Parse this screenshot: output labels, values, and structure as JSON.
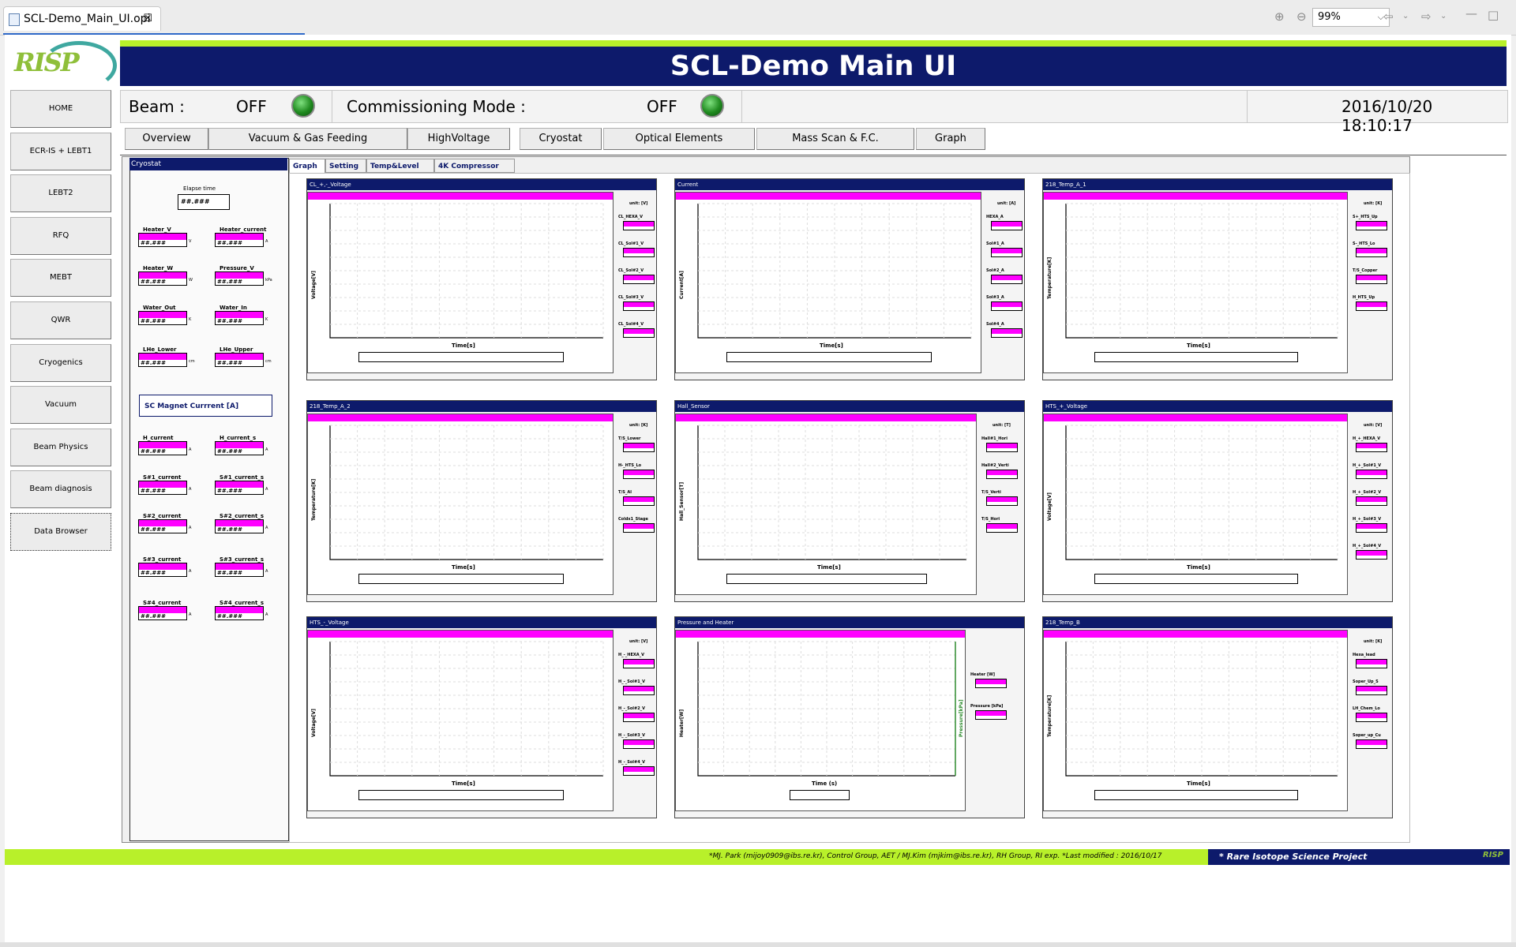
{
  "editor": {
    "tab_title": "SCL-Demo_Main_UI.opi",
    "zoom": "99%"
  },
  "app": {
    "title": "SCL-Demo Main UI",
    "logo_text": "RISP"
  },
  "sidebar": {
    "items": [
      {
        "label": "HOME"
      },
      {
        "label": "ECR-IS + LEBT1"
      },
      {
        "label": "LEBT2"
      },
      {
        "label": "RFQ"
      },
      {
        "label": "MEBT"
      },
      {
        "label": "QWR"
      },
      {
        "label": "Cryogenics"
      },
      {
        "label": "Vacuum"
      },
      {
        "label": "Beam Physics"
      },
      {
        "label": "Beam diagnosis"
      },
      {
        "label": "Data Browser"
      }
    ]
  },
  "status": {
    "beam_label": "Beam :",
    "beam_value": "OFF",
    "commissioning_label": "Commissioning Mode :",
    "commissioning_value": "OFF",
    "datetime": "2016/10/20 18:10:17",
    "led_color": "#1f8a1f"
  },
  "nav_tabs": [
    {
      "label": "Overview"
    },
    {
      "label": "Vacuum & Gas Feeding"
    },
    {
      "label": "HighVoltage"
    },
    {
      "label": "Cryostat"
    },
    {
      "label": "Optical Elements"
    },
    {
      "label": "Mass Scan & F.C."
    },
    {
      "label": "Graph"
    }
  ],
  "cryostat": {
    "header": "Cryostat",
    "elapse_label": "Elapse time",
    "elapse_value": "##.###",
    "placeholder": "##.###",
    "fields": [
      {
        "label": "Heater_V",
        "unit": "V"
      },
      {
        "label": "Heater_current",
        "unit": "A"
      },
      {
        "label": "Heater_W",
        "unit": "W"
      },
      {
        "label": "Pressure_V",
        "unit": "kPa"
      },
      {
        "label": "Water_Out",
        "unit": "K"
      },
      {
        "label": "Water_In",
        "unit": "K"
      },
      {
        "label": "LHe_Lower",
        "unit": "cm"
      },
      {
        "label": "LHe_Upper",
        "unit": "cm"
      }
    ],
    "magnet_title": "SC Magnet Currrent [A]",
    "magnet_fields": [
      {
        "label": "H_current",
        "unit": "A"
      },
      {
        "label": "H_current_s",
        "unit": "A"
      },
      {
        "label": "S#1_current",
        "unit": "A"
      },
      {
        "label": "S#1_current_s",
        "unit": "A"
      },
      {
        "label": "S#2_current",
        "unit": "A"
      },
      {
        "label": "S#2_current_s",
        "unit": "A"
      },
      {
        "label": "S#3_current",
        "unit": "A"
      },
      {
        "label": "S#3_current_s",
        "unit": "A"
      },
      {
        "label": "S#4_current",
        "unit": "A"
      },
      {
        "label": "S#4_current_s",
        "unit": "A"
      }
    ]
  },
  "subtabs": [
    {
      "label": "Graph"
    },
    {
      "label": "Setting"
    },
    {
      "label": "Temp&Level"
    },
    {
      "label": "4K Compressor"
    }
  ],
  "charts": [
    {
      "title": "CL_+,-_Voltage",
      "ylabel": "Voltage[V]",
      "xlabel": "Time[s]",
      "unit": "unit: [V]",
      "signals": [
        "CL_HEXA_V",
        "CL_Sol#1_V",
        "CL_Sol#2_V",
        "CL_Sol#3_V",
        "CL_Sol#4_V"
      ]
    },
    {
      "title": "Current",
      "ylabel": "Current[A]",
      "xlabel": "Time[s]",
      "unit": "unit: [A]",
      "signals": [
        "HEXA_A",
        "Sol#1_A",
        "Sol#2_A",
        "Sol#3_A",
        "Sol#4_A"
      ]
    },
    {
      "title": "218_Temp_A_1",
      "ylabel": "Temperature[K]",
      "xlabel": "Time[s]",
      "unit": "unit: [K]",
      "signals": [
        "S+_HTS_Up",
        "S-_HTS_Lo",
        "T/S_Copper",
        "H_HTS_Up"
      ]
    },
    {
      "title": "218_Temp_A_2",
      "ylabel": "Temperature[K]",
      "xlabel": "Time[s]",
      "unit": "unit: [K]",
      "signals": [
        "T/S_Lower",
        "H-_HTS_Lo",
        "T/S_Al",
        "Coldx1_Stage"
      ]
    },
    {
      "title": "Hall_Sensor",
      "ylabel": "Hall_Sensor[T]",
      "xlabel": "Time[s]",
      "unit": "unit: [T]",
      "signals": [
        "Hall#1_Hori",
        "Hall#2_Verti",
        "T/S_Verti",
        "T/S_Hori"
      ]
    },
    {
      "title": "HTS_+_Voltage",
      "ylabel": "Voltage[V]",
      "xlabel": "Time[s]",
      "unit": "unit: [V]",
      "signals": [
        "H_+_HEXA_V",
        "H_+_Sol#1_V",
        "H_+_Sol#2_V",
        "H_+_Sol#3_V",
        "H_+_Sol#4_V"
      ]
    },
    {
      "title": "HTS_-_Voltage",
      "ylabel": "Voltage[V]",
      "xlabel": "Time[s]",
      "unit": "unit: [V]",
      "signals": [
        "H_-_HEXA_V",
        "H_-_Sol#1_V",
        "H_-_Sol#2_V",
        "H_-_Sol#3_V",
        "H_-_Sol#4_V"
      ]
    },
    {
      "title": "Pressure and Heater",
      "ylabel": "Heater[W]",
      "y2label": "Pressure[kPa]",
      "xlabel": "Time (s)",
      "unit": "",
      "signals": [
        "Heater [W]",
        "Pressure [kPa]"
      ]
    },
    {
      "title": "218_Temp_B",
      "ylabel": "Temperature[K]",
      "xlabel": "Time[s]",
      "unit": "unit: [K]",
      "signals": [
        "Hexa_lead",
        "Soper_Up_S",
        "LH_Chem_Lo",
        "Soper_up_Cu"
      ]
    }
  ],
  "footer": {
    "credits": "*MJ. Park (mijoy0909@ibs.re.kr), Control Group, AET / MJ.Kim (mjkim@ibs.re.kr), RH Group, RI exp.   *Last modified : 2016/10/17",
    "project": "* Rare Isotope Science Project",
    "logo": "RISP"
  }
}
